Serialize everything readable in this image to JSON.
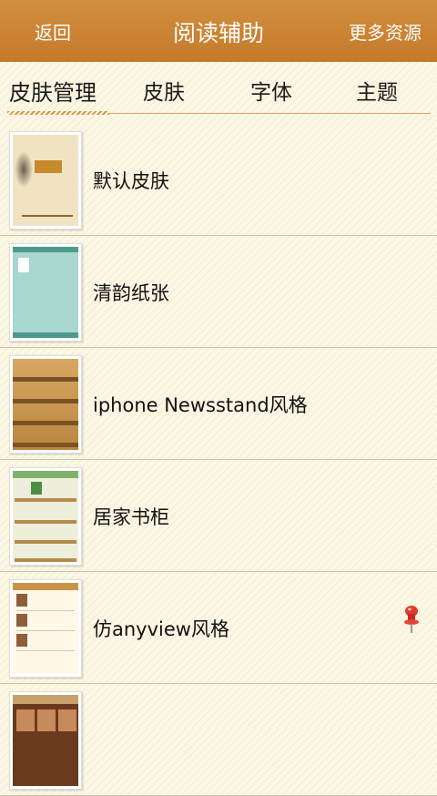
{
  "titlebar": {
    "back_label": "返回",
    "title": "阅读辅助",
    "more_label": "更多资源"
  },
  "tabs": [
    {
      "label": "皮肤管理",
      "active": true
    },
    {
      "label": "皮肤",
      "active": false
    },
    {
      "label": "字体",
      "active": false
    },
    {
      "label": "主题",
      "active": false
    }
  ],
  "skins": [
    {
      "name": "默认皮肤",
      "thumbnail": "default-skin-thumbnail"
    },
    {
      "name": "清韵纸张",
      "thumbnail": "paper-skin-thumbnail"
    },
    {
      "name": "iphone Newsstand风格",
      "thumbnail": "bookshelf-skin-thumbnail"
    },
    {
      "name": "居家书柜",
      "thumbnail": "home-bookcase-thumbnail"
    },
    {
      "name": "仿anyview风格",
      "thumbnail": "anyview-skin-thumbnail",
      "in_use_icon": "red-pushpin-icon"
    },
    {
      "name": "",
      "thumbnail": "partial-skin-thumbnail"
    }
  ],
  "colors": {
    "titlebar": "#c98431",
    "background": "#fbf7e4",
    "tab_underline": "#d9953f"
  }
}
